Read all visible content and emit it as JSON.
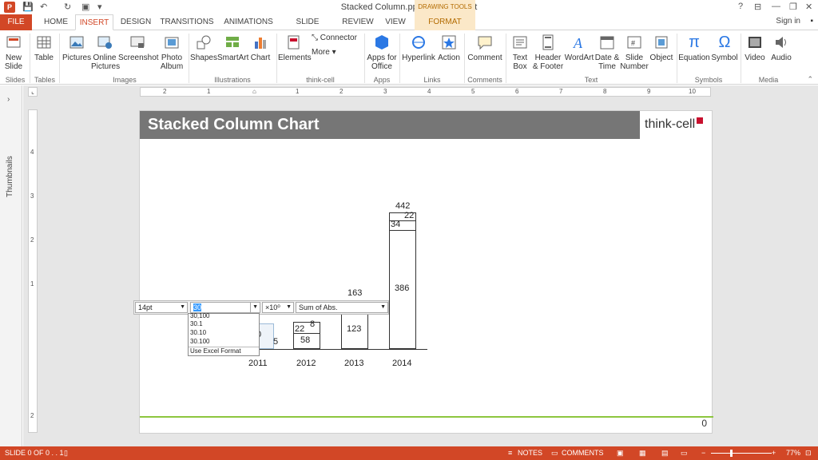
{
  "window": {
    "title": "Stacked Column.pptx - PowerPoint",
    "context_label": "DRAWING TOOLS",
    "sign_in": "Sign in"
  },
  "tabs": [
    "FILE",
    "HOME",
    "INSERT",
    "DESIGN",
    "TRANSITIONS",
    "ANIMATIONS",
    "SLIDE SHOW",
    "REVIEW",
    "VIEW",
    "FORMAT"
  ],
  "ribbon": {
    "buttons": {
      "new_slide": "New Slide",
      "table": "Table",
      "pictures": "Pictures",
      "online_pictures": "Online Pictures",
      "screenshot": "Screenshot",
      "photo_album": "Photo Album",
      "shapes": "Shapes",
      "smartart": "SmartArt",
      "chart": "Chart",
      "elements": "Elements",
      "connector": "Connector",
      "more": "More",
      "apps_for_office": "Apps for Office",
      "hyperlink": "Hyperlink",
      "action": "Action",
      "comment": "Comment",
      "text_box": "Text Box",
      "header_footer": "Header & Footer",
      "wordart": "WordArt",
      "date_time": "Date & Time",
      "slide_number": "Slide Number",
      "object": "Object",
      "equation": "Equation",
      "symbol": "Symbol",
      "video": "Video",
      "audio": "Audio"
    },
    "groups": {
      "slides": "Slides",
      "tables": "Tables",
      "images": "Images",
      "illustrations": "Illustrations",
      "think_cell": "think-cell",
      "apps": "Apps",
      "links": "Links",
      "comments": "Comments",
      "text": "Text",
      "symbols": "Symbols",
      "media": "Media"
    }
  },
  "left_panel": {
    "label": "Thumbnails"
  },
  "slide": {
    "title": "Stacked Column Chart",
    "logo_text": "think-cell",
    "page_number": "0"
  },
  "chart_data": {
    "type": "bar",
    "stacked": true,
    "categories": [
      "2011",
      "2012",
      "2013",
      "2014"
    ],
    "totals": [
      "",
      "",
      "163",
      "442"
    ],
    "segments": [
      {
        "category": "2011",
        "labels": [
          "",
          "0",
          "5"
        ]
      },
      {
        "category": "2012",
        "labels": [
          "58",
          "22",
          "8"
        ]
      },
      {
        "category": "2013",
        "labels": [
          "123",
          "",
          ""
        ]
      },
      {
        "category": "2014",
        "labels": [
          "386",
          "34",
          "22"
        ]
      }
    ]
  },
  "float_toolbar": {
    "font_size": "14pt",
    "number_value": "30",
    "multiplier": "×10⁰",
    "sum_mode": "Sum of Abs.",
    "dropdown_options": [
      "30,100",
      "30.1",
      "30.10",
      "30.100",
      "Use Excel Format"
    ]
  },
  "status": {
    "slide_info": "SLIDE 0 OF 0 . . 1",
    "notes": "NOTES",
    "comments": "COMMENTS",
    "zoom": "77%"
  },
  "colors": {
    "accent": "#d24726",
    "slide_header": "#767676",
    "green_line": "#8dc63f",
    "contextual": "#fbe8c8"
  }
}
